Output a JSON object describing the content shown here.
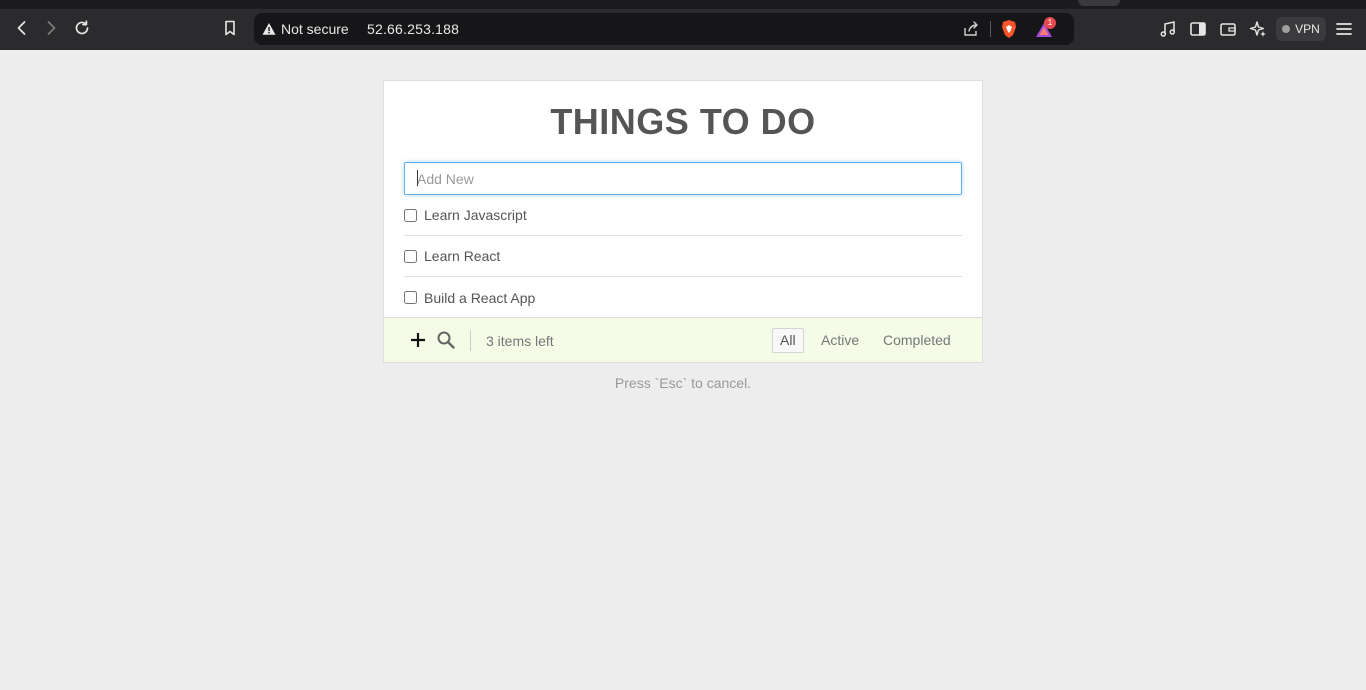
{
  "browser": {
    "security_label": "Not secure",
    "url": "52.66.253.188",
    "rewards_badge": "1",
    "vpn_label": "VPN"
  },
  "app": {
    "title": "THINGS TO DO",
    "input_placeholder": "Add New",
    "input_value": "",
    "todos": [
      {
        "label": "Learn Javascript",
        "checked": false
      },
      {
        "label": "Learn React",
        "checked": false
      },
      {
        "label": "Build a React App",
        "checked": false
      }
    ],
    "footer": {
      "items_left": "3 items left",
      "filters": [
        "All",
        "Active",
        "Completed"
      ],
      "selected_filter": "All"
    },
    "hint": "Press `Esc` to cancel."
  },
  "icons": {
    "back": "chevron-left-icon",
    "forward": "chevron-right-icon",
    "reload": "reload-icon",
    "bookmark": "bookmark-icon",
    "add": "plus-icon",
    "search": "search-icon"
  },
  "colors": {
    "chrome_bg": "#2b2b2d",
    "page_bg": "#ededed",
    "footer_bg": "#f4fce8",
    "input_focus": "#66afe9"
  }
}
